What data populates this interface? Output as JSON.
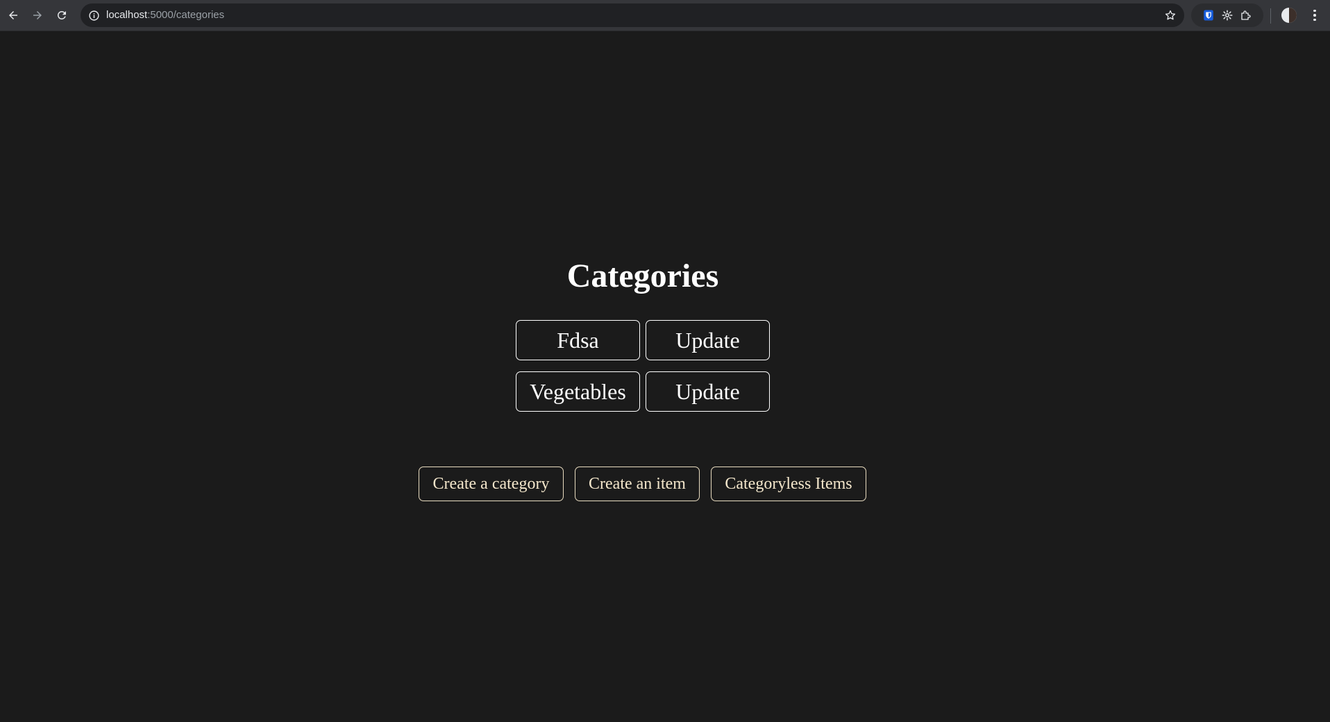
{
  "browser": {
    "url_host": "localhost",
    "url_path": ":5000/categories",
    "icons": [
      "back-arrow-icon",
      "forward-arrow-icon",
      "reload-icon",
      "site-info-icon",
      "bookmark-star-icon",
      "bitwarden-shield-icon",
      "extension-gear-icon",
      "extensions-puzzle-icon",
      "profile-avatar",
      "kebab-menu-icon"
    ]
  },
  "page": {
    "title": "Categories",
    "categories": [
      {
        "name": "Fdsa",
        "update_label": "Update"
      },
      {
        "name": "Vegetables",
        "update_label": "Update"
      }
    ],
    "actions": {
      "create_category": "Create a category",
      "create_item": "Create an item",
      "categoryless_items": "Categoryless Items"
    }
  },
  "colors": {
    "background": "#1b1b1b",
    "chrome": "#35363a",
    "category_button_border": "#ffffff",
    "action_button_border": "#e9dcc0",
    "action_button_text": "#f3e6cb"
  }
}
